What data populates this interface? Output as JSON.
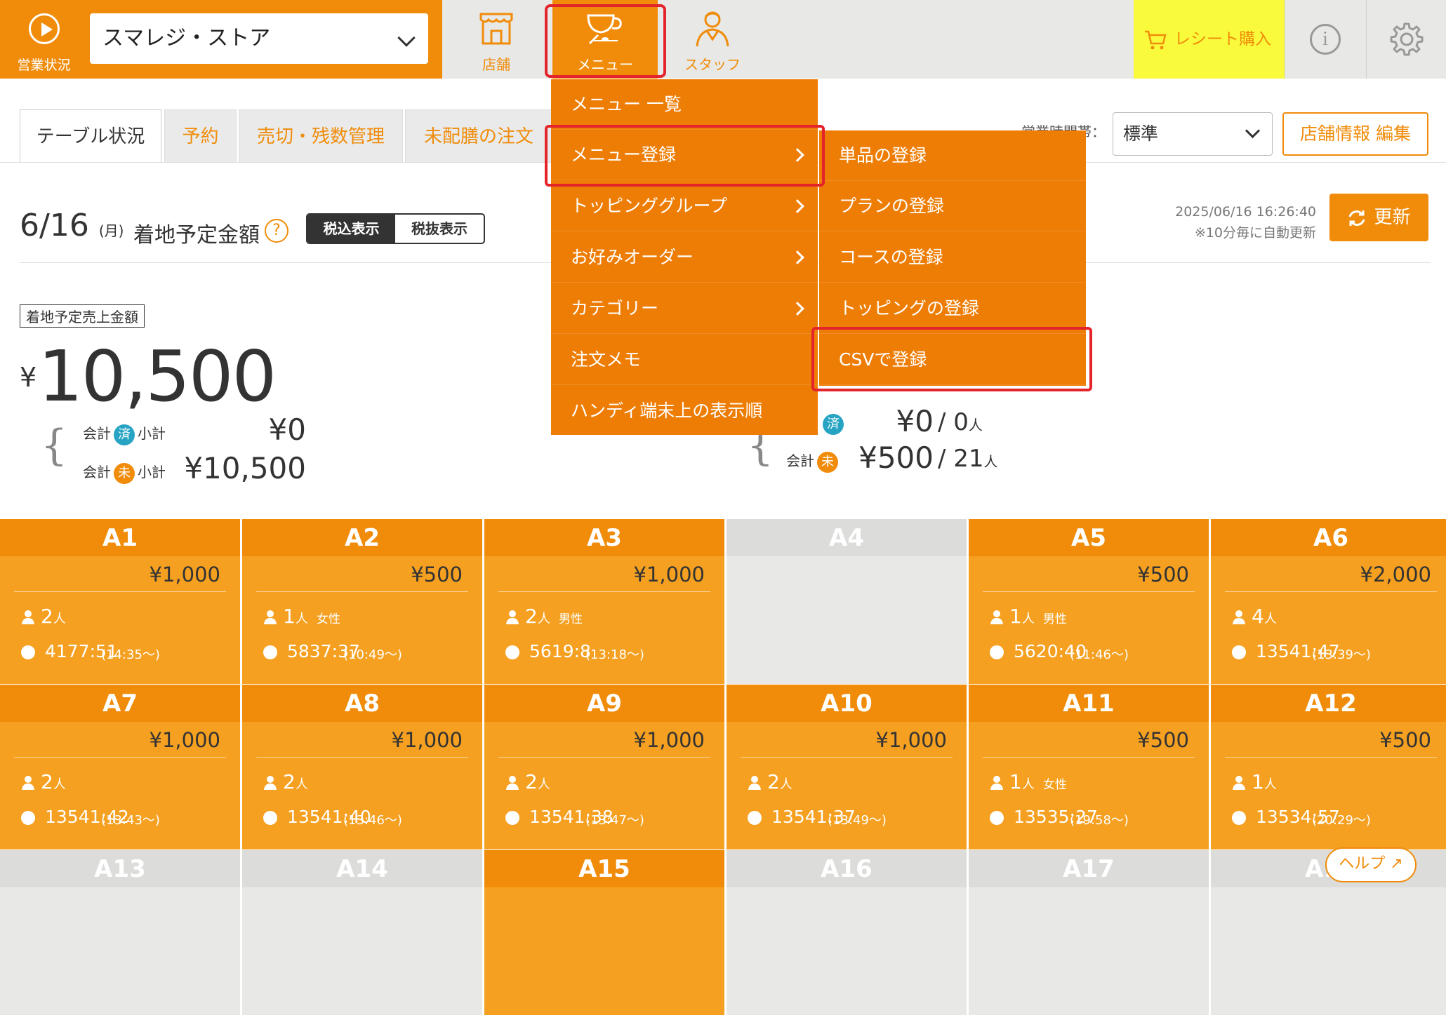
{
  "header": {
    "status_label": "営業状況",
    "store_name": "スマレジ・ストア",
    "nav": [
      {
        "label": "店舗",
        "icon": "store-icon"
      },
      {
        "label": "メニュー",
        "icon": "menu-icon"
      },
      {
        "label": "スタッフ",
        "icon": "staff-icon"
      }
    ],
    "receipt_label": "レシート購入",
    "info_icon": "info-icon",
    "settings_icon": "gear-icon"
  },
  "tabs": [
    "テーブル状況",
    "予約",
    "売切・残数管理",
    "未配膳の注文"
  ],
  "business_hours": {
    "label": "営業時間帯：",
    "value": "標準"
  },
  "store_edit_label": "店舗情報 編集",
  "summary": {
    "date": "6/16",
    "weekday": "(月)",
    "landing_label": "着地予定金額",
    "tax_in": "税込表示",
    "tax_out": "税抜表示",
    "timestamp": "2025/06/16 16:26:40",
    "auto_update": "※10分毎に自動更新",
    "refresh_label": "更新",
    "sales_label": "着地予定売上金額",
    "yen": "¥",
    "total": "10,500",
    "paid_label": "会計",
    "paid_badge": "済",
    "unpaid_badge": "未",
    "subtotal_label": "小計",
    "paid_subtotal": "¥0",
    "unpaid_subtotal": "¥10,500",
    "right_paid_amount": "¥0",
    "right_paid_people": "0",
    "right_unpaid_amount": "¥500",
    "right_unpaid_people": "21",
    "people_unit": "人",
    "slash": "/"
  },
  "menu_dropdown": {
    "items": [
      "メニュー 一覧",
      "メニュー登録",
      "トッピンググループ",
      "お好みオーダー",
      "カテゴリー",
      "注文メモ",
      "ハンディ端末上の表示順"
    ],
    "submenu": [
      "単品の登録",
      "プランの登録",
      "コースの登録",
      "トッピングの登録",
      "CSVで登録"
    ]
  },
  "tables": [
    {
      "name": "A1",
      "price": "¥1,000",
      "guests": "2",
      "gender": "",
      "elapsed": "4177:51",
      "start": "(14:35〜)"
    },
    {
      "name": "A2",
      "price": "¥500",
      "guests": "1",
      "gender": "女性",
      "elapsed": "5837:37",
      "start": "(10:49〜)"
    },
    {
      "name": "A3",
      "price": "¥1,000",
      "guests": "2",
      "gender": "男性",
      "elapsed": "5619:8",
      "start": "(13:18〜)"
    },
    {
      "name": "A4",
      "empty": true
    },
    {
      "name": "A5",
      "price": "¥500",
      "guests": "1",
      "gender": "男性",
      "elapsed": "5620:40",
      "start": "(11:46〜)"
    },
    {
      "name": "A6",
      "price": "¥2,000",
      "guests": "4",
      "gender": "",
      "elapsed": "13541:47",
      "start": "(13:39〜)"
    },
    {
      "name": "A7",
      "price": "¥1,000",
      "guests": "2",
      "gender": "",
      "elapsed": "13541:42",
      "start": "(13:43〜)"
    },
    {
      "name": "A8",
      "price": "¥1,000",
      "guests": "2",
      "gender": "",
      "elapsed": "13541:40",
      "start": "(13:46〜)"
    },
    {
      "name": "A9",
      "price": "¥1,000",
      "guests": "2",
      "gender": "",
      "elapsed": "13541:38",
      "start": "(13:47〜)"
    },
    {
      "name": "A10",
      "price": "¥1,000",
      "guests": "2",
      "gender": "",
      "elapsed": "13541:37",
      "start": "(13:49〜)"
    },
    {
      "name": "A11",
      "price": "¥500",
      "guests": "1",
      "gender": "女性",
      "elapsed": "13535:27",
      "start": "(19:58〜)"
    },
    {
      "name": "A12",
      "price": "¥500",
      "guests": "1",
      "gender": "",
      "elapsed": "13534:57",
      "start": "(20:29〜)"
    },
    {
      "name": "A13",
      "empty": true
    },
    {
      "name": "A14",
      "empty": true
    },
    {
      "name": "A15",
      "empty": false,
      "partial": true
    },
    {
      "name": "A16",
      "empty": true
    },
    {
      "name": "A17",
      "empty": true
    },
    {
      "name": "A18",
      "empty": true
    }
  ],
  "help_label": "ヘルプ",
  "colors": {
    "accent": "#f08c0a",
    "highlight": "#e4242b",
    "paid": "#27a4c3"
  }
}
